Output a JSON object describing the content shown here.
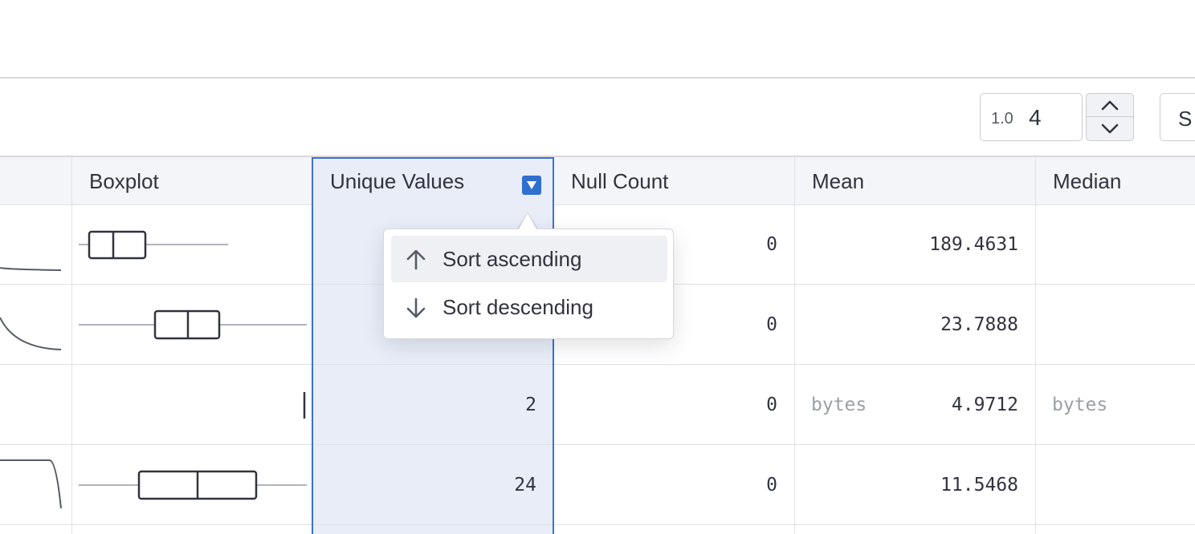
{
  "toolbar": {
    "precision_prefix": "1.0",
    "precision_value": "4",
    "next_control_label": "S"
  },
  "table": {
    "headers": {
      "boxplot": "Boxplot",
      "unique_values": "Unique Values",
      "null_count": "Null Count",
      "mean": "Mean",
      "median": "Median"
    },
    "rows": [
      {
        "unique_values": "",
        "null_count": "0",
        "mean": "189.4631",
        "mean_type": "",
        "median_type": ""
      },
      {
        "unique_values": "",
        "null_count": "0",
        "mean": "23.7888",
        "mean_type": "",
        "median_type": ""
      },
      {
        "unique_values": "2",
        "null_count": "0",
        "mean": "4.9712",
        "mean_type": "bytes",
        "median_type": "bytes"
      },
      {
        "unique_values": "24",
        "null_count": "0",
        "mean": "11.5468",
        "mean_type": "",
        "median_type": ""
      }
    ]
  },
  "sort_menu": {
    "items": [
      {
        "label": "Sort ascending",
        "icon": "arrow-up-icon"
      },
      {
        "label": "Sort descending",
        "icon": "arrow-down-icon"
      }
    ]
  },
  "colors": {
    "selected_column_bg": "#e8edf8",
    "selected_column_border": "#3a73cf",
    "sort_button": "#2f6fce"
  }
}
